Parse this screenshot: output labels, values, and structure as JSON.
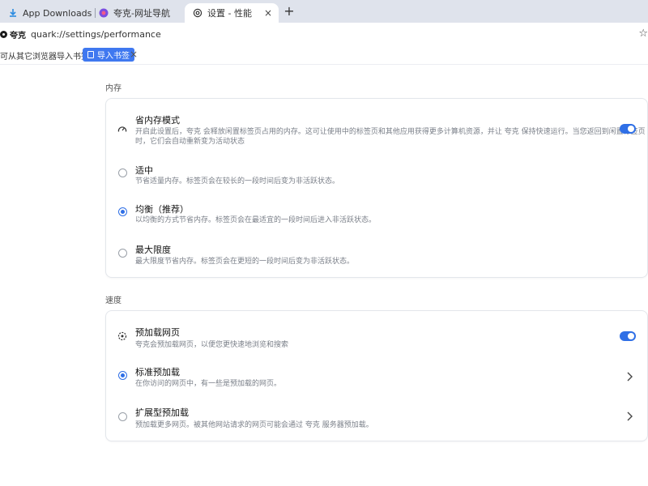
{
  "tabs": [
    {
      "label": "App Downloads for Wi",
      "icon": "download-icon"
    },
    {
      "label": "夸克-网址导航",
      "icon": "quark-nav-icon"
    },
    {
      "label": "设置 - 性能",
      "icon": "gear-icon",
      "active": true
    }
  ],
  "tab_close_glyph": "×",
  "new_tab_glyph": "+",
  "address": {
    "site_label": "夸克",
    "url": "quark://settings/performance",
    "star_glyph": "☆"
  },
  "bookmarks_bar": {
    "prompt_text": "可从其它浏览器导入书签",
    "import_button": "导入书签",
    "close_glyph": "×"
  },
  "memory": {
    "section_title": "内存",
    "saver": {
      "title": "省内存模式",
      "desc_line1": "开启此设置后，夸克 会释放闲置标签页占用的内存。这可让使用中的标签页和其他应用获得更多计算机资源，并让 夸克 保持快速运行。当您返回到闲置标签页",
      "desc_line2": "时，它们会自动重新变为活动状态",
      "enabled": true
    },
    "options": [
      {
        "title": "适中",
        "desc": "节省适量内存。标签页会在较长的一段时间后变为非活跃状态。",
        "selected": false
      },
      {
        "title": "均衡（推荐）",
        "desc": "以均衡的方式节省内存。标签页会在最适宜的一段时间后进入非活跃状态。",
        "selected": true
      },
      {
        "title": "最大限度",
        "desc": "最大限度节省内存。标签页会在更短的一段时间后变为非活跃状态。",
        "selected": false
      }
    ]
  },
  "speed": {
    "section_title": "速度",
    "preload": {
      "title": "预加载网页",
      "desc": "夸克会预加载网页，以便您更快速地浏览和搜索",
      "enabled": true
    },
    "options": [
      {
        "title": "标准预加载",
        "desc": "在你访问的网页中，有一些是预加载的网页。",
        "selected": true
      },
      {
        "title": "扩展型预加载",
        "desc": "预加载更多网页。被其他网站请求的网页可能会通过 夸克 服务器预加载。",
        "selected": false
      }
    ]
  },
  "colors": {
    "accent": "#2f6fe6",
    "tabstrip": "#dfe3ec"
  }
}
